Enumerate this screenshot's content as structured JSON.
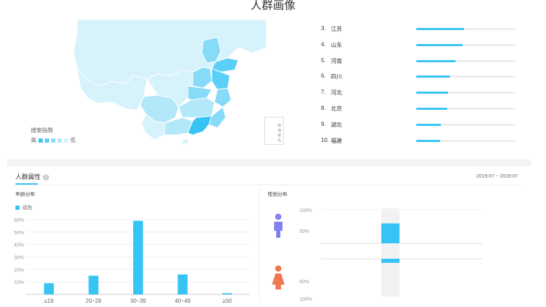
{
  "page": {
    "title": "人群画像"
  },
  "map": {
    "legend_title": "搜索指数",
    "legend_high": "高",
    "legend_low": "低",
    "inset_label": "南海\n诸岛",
    "colors": [
      "#36c4f4",
      "#5ccff6",
      "#86dbf8",
      "#b2e8f9",
      "#d6f2fb"
    ]
  },
  "ranking": [
    {
      "rank": "3.",
      "name": "江苏",
      "value": 0.48
    },
    {
      "rank": "4.",
      "name": "山东",
      "value": 0.47
    },
    {
      "rank": "5.",
      "name": "河南",
      "value": 0.4
    },
    {
      "rank": "6.",
      "name": "四川",
      "value": 0.34
    },
    {
      "rank": "7.",
      "name": "河北",
      "value": 0.32
    },
    {
      "rank": "8.",
      "name": "北京",
      "value": 0.31
    },
    {
      "rank": "9.",
      "name": "湖北",
      "value": 0.25
    },
    {
      "rank": "10.",
      "name": "福建",
      "value": 0.24
    }
  ],
  "attributes": {
    "tab_label": "人群属性",
    "help_icon": "question-icon",
    "date_range": "2019-07 ~ 2019-07"
  },
  "age_section": {
    "title": "年龄分布",
    "legend_label": "成色"
  },
  "gender_section": {
    "title": "性别分布",
    "male_icon": "male-icon",
    "female_icon": "female-icon",
    "male_color": "#8080f0",
    "female_color": "#f07850"
  },
  "chart_data": [
    {
      "type": "bar",
      "categories": [
        "≤19",
        "20~29",
        "30~39",
        "40~49",
        "≥50"
      ],
      "values": [
        9,
        15,
        59,
        16,
        1
      ],
      "series": [
        {
          "name": "成色",
          "values": [
            9,
            15,
            59,
            16,
            1
          ]
        }
      ],
      "yticks": [
        "10%",
        "20%",
        "30%",
        "40%",
        "50%",
        "60%"
      ],
      "ylim": [
        0,
        65
      ],
      "grid": true,
      "color": "#36c4f4"
    },
    {
      "type": "bar",
      "categories": [
        "男",
        "女"
      ],
      "values": [
        35,
        9
      ],
      "yticks_top": [
        "100%",
        "50%"
      ],
      "yticks_bottom": [
        "50%",
        "100%"
      ],
      "ylim": [
        0,
        100
      ],
      "color": "#36c4f4"
    }
  ]
}
